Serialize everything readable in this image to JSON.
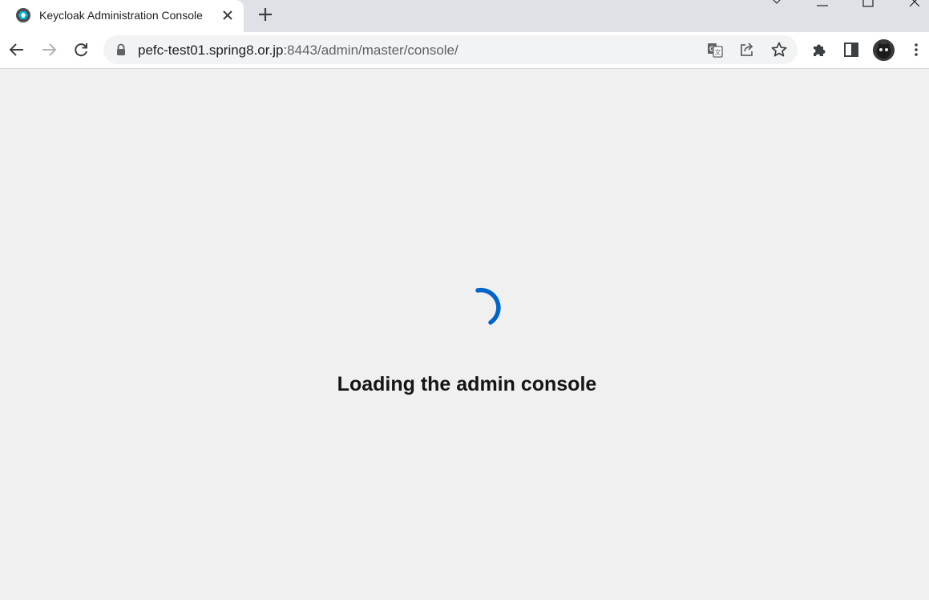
{
  "browser": {
    "tab": {
      "title": "Keycloak Administration Console",
      "favicon": "keycloak-logo-icon",
      "close_icon": "close-icon"
    },
    "new_tab_icon": "plus-icon",
    "window_controls": [
      "chevron-down-icon",
      "minimize-icon",
      "maximize-icon",
      "close-icon"
    ],
    "toolbar": {
      "back_icon": "back-arrow-icon",
      "forward_icon": "forward-arrow-icon",
      "reload_icon": "reload-icon",
      "url_host": "pefc-test01.spring8.or.jp",
      "url_rest": ":8443/admin/master/console/",
      "omnibox_icons": [
        "translate-icon",
        "share-icon",
        "star-icon"
      ],
      "right_icons": [
        "extensions-icon",
        "side-panel-icon",
        "profile-avatar",
        "kebab-menu-icon"
      ]
    }
  },
  "page": {
    "spinner_color": "#0066cc",
    "loading_text": "Loading the admin console"
  },
  "colors": {
    "tabstrip": "#dee1e6",
    "page_bg": "#f0f0f0",
    "accent": "#0066cc"
  }
}
